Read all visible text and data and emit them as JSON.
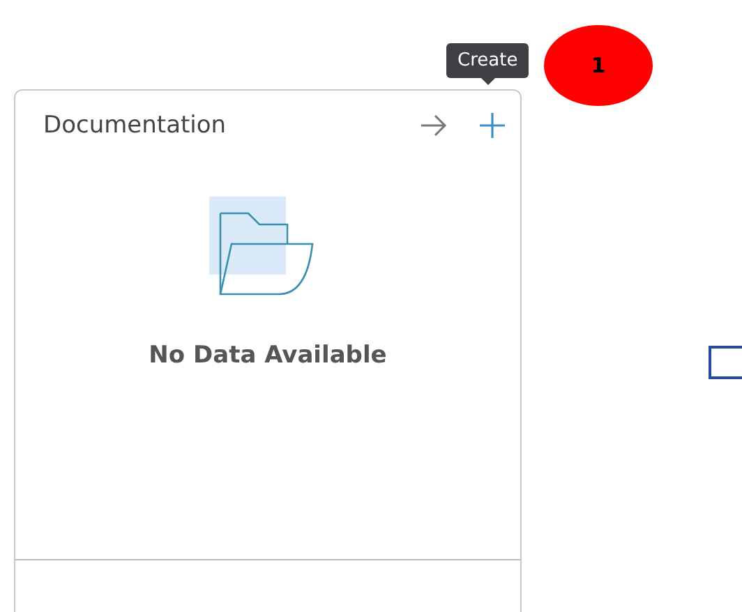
{
  "card": {
    "title": "Documentation",
    "empty_message": "No Data Available"
  },
  "tooltip": {
    "text": "Create"
  },
  "step_badge": {
    "text": "1"
  }
}
